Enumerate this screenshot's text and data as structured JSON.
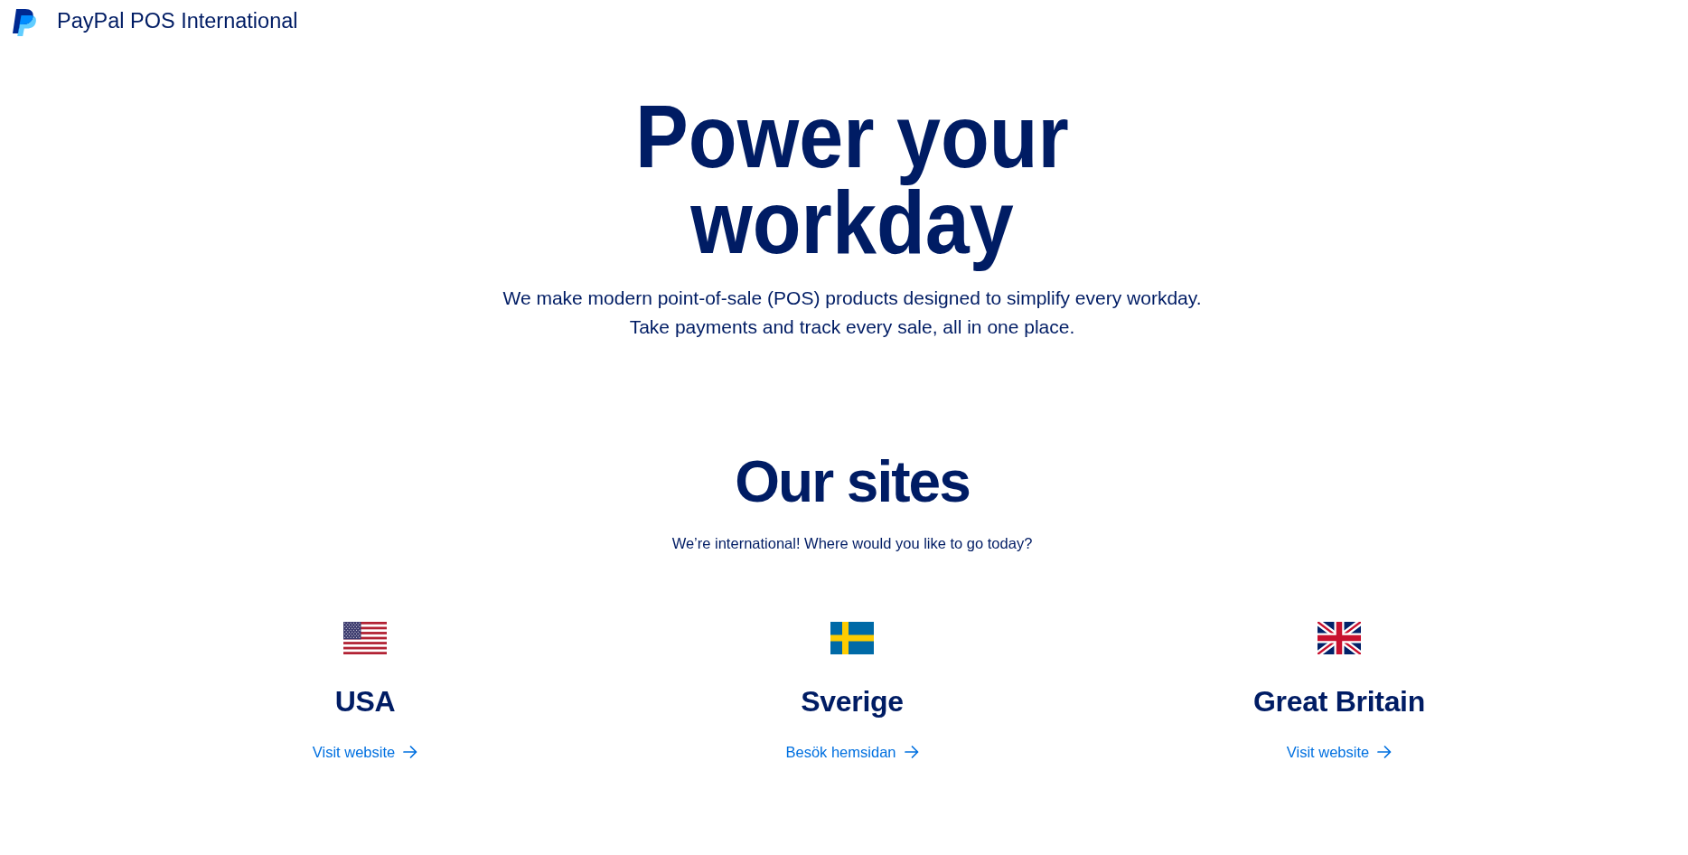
{
  "header": {
    "title": "PayPal POS International"
  },
  "hero": {
    "title": "Power your workday",
    "description": "We make modern point-of-sale (POS) products designed to simplify every workday. Take payments and track every sale, all in one place."
  },
  "sites_section": {
    "title": "Our sites",
    "subtitle": "We’re international! Where would you like to go today?",
    "sites": [
      {
        "kind": "usa",
        "name": "USA",
        "link": "Visit website"
      },
      {
        "kind": "sweden",
        "name": "Sverige",
        "link": "Besök hemsidan"
      },
      {
        "kind": "britain",
        "name": "Great Britain",
        "link": "Visit website"
      }
    ]
  }
}
